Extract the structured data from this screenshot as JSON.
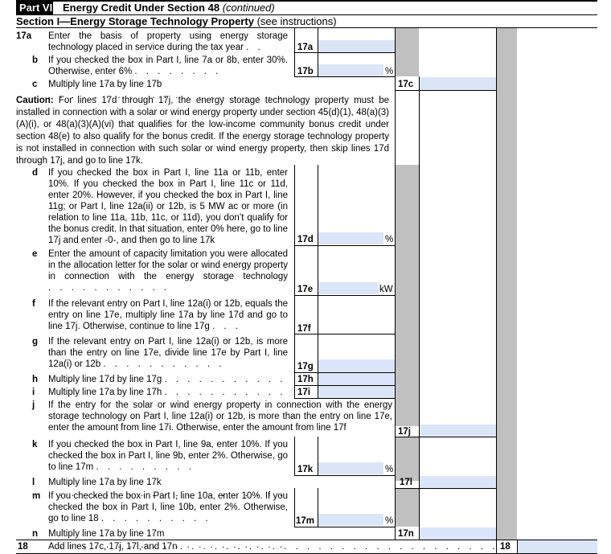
{
  "header": {
    "part": "Part VI",
    "title": "Energy Credit Under Section 48",
    "title_suffix": "(continued)",
    "section_bold": "Section I—Energy Storage Technology Property",
    "section_note": "(see instructions)"
  },
  "caution": {
    "label": "Caution:",
    "text": "For lines 17d through 17j, the energy storage technology property must be installed in connection with a solar or wind energy property under section 45(d)(1), 48(a)(3)(A)(i), or 48(a)(3)(A)(vi) that qualifies for the low-income community bonus credit under section 48(e) to also qualify for the bonus credit. If the energy storage technology property is not installed in connection with such solar or wind energy property, then skip lines 17d through 17j, and go to line 17k."
  },
  "lines": {
    "l17a": {
      "num": "17a",
      "text": "Enter the basis of property using energy storage technology placed in service during the tax year",
      "dots": ". .",
      "label": "17a"
    },
    "l17b": {
      "num": "b",
      "text": "If you checked the box in Part I, line 7a or 8b, enter 30%. Otherwise, enter 6%",
      "dots": ". . . . . . . .",
      "label": "17b",
      "unit": "%"
    },
    "l17c": {
      "num": "c",
      "text": "Multiply line 17a by line 17b",
      "dots": ". . . . . . . . . . . . . . . . . . . . .",
      "label": "17c"
    },
    "l17d": {
      "num": "d",
      "text": "If you checked the box in Part I, line 11a or 11b, enter 10%. If you checked the box in Part I, line 11c or 11d, enter 20%. However, if you checked the box in Part I, line 11g; or Part I, line 12a(ii) or 12b, is 5 MW ac or more (in relation to line 11a, 11b, 11c, or 11d), you don’t qualify for the bonus credit. In that situation, enter 0% here, go to line 17j and enter -0-, and then go to line 17k",
      "label": "17d",
      "unit": "%"
    },
    "l17e": {
      "num": "e",
      "text": "Enter the amount of capacity limitation you were allocated in the allocation letter for the solar or wind energy property in connection with the energy storage technology",
      "dots": ". . . . . . . . . . .",
      "label": "17e",
      "unit": "kW"
    },
    "l17f": {
      "num": "f",
      "text": "If the relevant entry on Part I, line 12a(i) or 12b, equals the entry on line 17e, multiply line 17a by line 17d and go to line 17j. Otherwise, continue to line 17g",
      "dots": ". . .",
      "label": "17f"
    },
    "l17g": {
      "num": "g",
      "text": "If the relevant entry on Part I, line 12a(i) or 12b, is more than the entry on line 17e, divide line 17e by Part I, line 12a(i) or 12b",
      "dots": ". . . . . . . . . . .",
      "label": "17g"
    },
    "l17h": {
      "num": "h",
      "text": "Multiply line 17d by line 17g",
      "dots": ". . . . . . . . . . .",
      "label": "17h"
    },
    "l17i": {
      "num": "i",
      "text": "Multiply line 17a by line 17h",
      "dots": ". . . . . . . . . . .",
      "label": "17i"
    },
    "l17j": {
      "num": "j",
      "text": "If the entry for the solar or wind energy property in connection with the energy storage technology on Part I, line 12a(i) or 12b, is more than the entry on line 17e, enter the amount from line 17i. Otherwise, enter the amount from line 17f",
      "label": "17j"
    },
    "l17k": {
      "num": "k",
      "text": "If you checked the box in Part I, line 9a, enter 10%. If you checked the box in Part I, line 9b, enter 2%. Otherwise, go to line 17m",
      "dots": ". . . . . . . . .",
      "label": "17k",
      "unit": "%"
    },
    "l17l": {
      "num": "l",
      "text": "Multiply line 17a by line 17k",
      "dots": ". . . . . . . . . . . . . . . . . . . . .",
      "label": "17l"
    },
    "l17m": {
      "num": "m",
      "text": "If you checked the box in Part I, line 10a, enter 10%. If you checked the box in Part I, line 10b, enter 2%. Otherwise, go to line 18",
      "dots": ". . . . . . . . . .",
      "label": "17m",
      "unit": "%"
    },
    "l17n": {
      "num": "n",
      "text": "Multiply line 17a by line 17m",
      "dots": ". . . . . . . . . . . . . . . . . . . . .",
      "label": "17n"
    },
    "l18": {
      "num": "18",
      "text": "Add lines 17c, 17j, 17l, and 17n",
      "dots": ". . . . . . . . . . . . . . . . . . . . . . . . . . . . . . . . . .",
      "label": "18"
    }
  }
}
